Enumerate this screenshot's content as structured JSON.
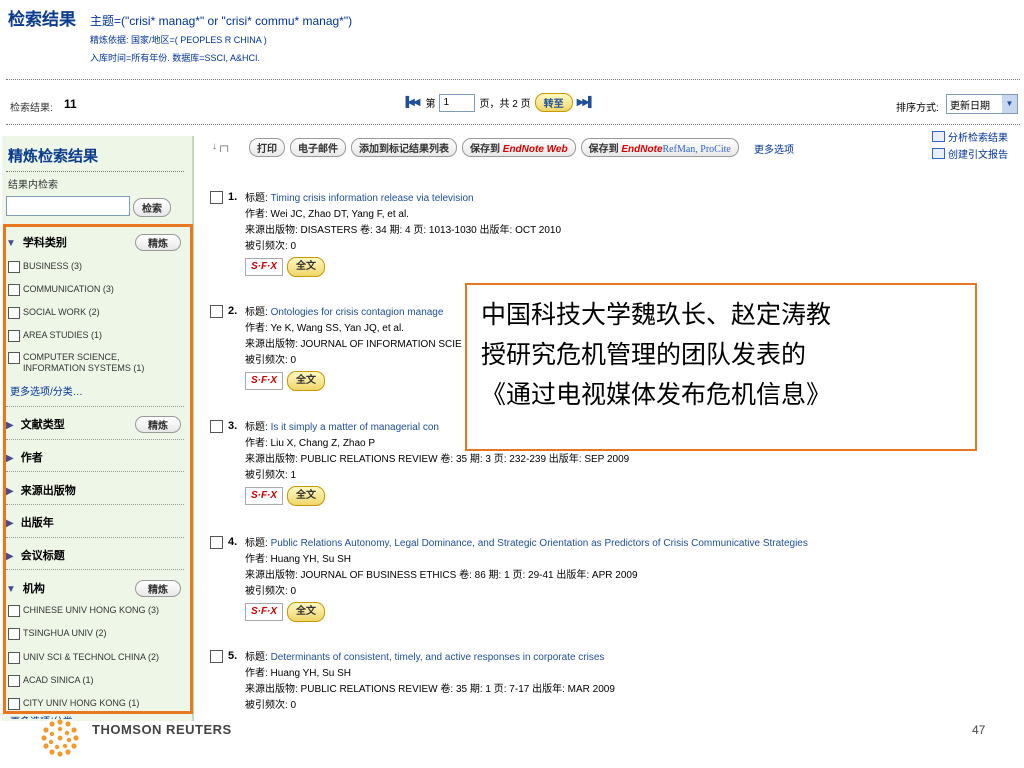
{
  "header": {
    "title": "检索结果",
    "query": "主题=(\"crisi* manag*\" or \"crisi* commu* manag*\")",
    "refine_basis": "精炼依据: 国家/地区=( PEOPLES R CHINA )",
    "time_db": "入库时间=所有年份. 数据库=SSCI, A&HCI."
  },
  "results_bar": {
    "count_label": "检索结果:",
    "count": "11",
    "page_prefix": "第",
    "page_value": "1",
    "page_suffix": "页，共 2 页",
    "goto_label": "转至",
    "sort_label": "排序方式:",
    "sort_value": "更新日期"
  },
  "sidebar": {
    "title": "精炼检索结果",
    "within_label": "结果内检索",
    "search_button": "检索",
    "refine_label": "精炼",
    "sections": {
      "subject": "学科类别",
      "doctype": "文献类型",
      "author": "作者",
      "source": "来源出版物",
      "year": "出版年",
      "conference": "会议标题",
      "institution": "机构"
    },
    "subject_items": [
      "BUSINESS (3)",
      "COMMUNICATION (3)",
      "SOCIAL WORK (2)",
      "AREA STUDIES (1)",
      "COMPUTER SCIENCE, INFORMATION SYSTEMS (1)"
    ],
    "institution_items": [
      "CHINESE UNIV HONG KONG (3)",
      "TSINGHUA UNIV (2)",
      "UNIV SCI & TECHNOL CHINA (2)",
      "ACAD SINICA (1)",
      "CITY UNIV HONG KONG (1)"
    ],
    "more_label": "更多选项/分类…",
    "more_cut_label": "更多选项/分类…"
  },
  "toolbar": {
    "print": "打印",
    "email": "电子邮件",
    "add_marked": "添加到标记结果列表",
    "save_to": "保存到",
    "endnote_web": "EndNote Web",
    "endnote": "EndNote",
    "refman": "RefMan, ProCite",
    "more_options": "更多选项",
    "analyze": "分析检索结果",
    "citation_report": "创建引文报告"
  },
  "record_labels": {
    "title": "标题:",
    "sfx": "S·F·X",
    "fulltext": "全文"
  },
  "records": [
    {
      "num": "1.",
      "title": "Timing crisis information release via television",
      "authors": "作者: Wei JC, Zhao DT, Yang F, et al.",
      "source": "来源出版物: DISASTERS  卷: 34  期: 4  页: 1013-1030  出版年: OCT 2010",
      "cited": "被引频次: 0"
    },
    {
      "num": "2.",
      "title": "Ontologies for crisis contagion manage",
      "authors": "作者: Ye K, Wang SS, Yan JQ, et al.",
      "source": "来源出版物: JOURNAL OF INFORMATION SCIE",
      "cited": "被引频次: 0"
    },
    {
      "num": "3.",
      "title": "Is it simply a matter of managerial con",
      "authors": "作者: Liu X, Chang Z, Zhao P",
      "source": "来源出版物: PUBLIC RELATIONS REVIEW  卷: 35  期: 3  页: 232-239  出版年: SEP 2009",
      "cited": "被引频次: 1"
    },
    {
      "num": "4.",
      "title": "Public Relations Autonomy, Legal Dominance, and Strategic Orientation as Predictors of Crisis Communicative Strategies",
      "authors": "作者: Huang YH, Su SH",
      "source": "来源出版物: JOURNAL OF BUSINESS ETHICS  卷: 86  期: 1  页: 29-41  出版年: APR 2009",
      "cited": "被引频次: 0"
    },
    {
      "num": "5.",
      "title": "Determinants of consistent, timely, and active responses in corporate crises",
      "authors": "作者: Huang YH, Su SH",
      "source": "来源出版物: PUBLIC RELATIONS REVIEW  卷: 35  期: 1  页: 7-17  出版年: MAR 2009",
      "cited": "被引频次: 0"
    }
  ],
  "callout": {
    "line1": "中国科技大学魏玖长、赵定涛教",
    "line2": "授研究危机管理的团队发表的",
    "line3": "《通过电视媒体发布危机信息》"
  },
  "footer": {
    "brand": "THOMSON REUTERS",
    "page_number": "47"
  },
  "colors": {
    "accent_orange": "#e87722",
    "link_blue": "#1f4f9a",
    "sidebar_bg": "#eef6e8"
  }
}
